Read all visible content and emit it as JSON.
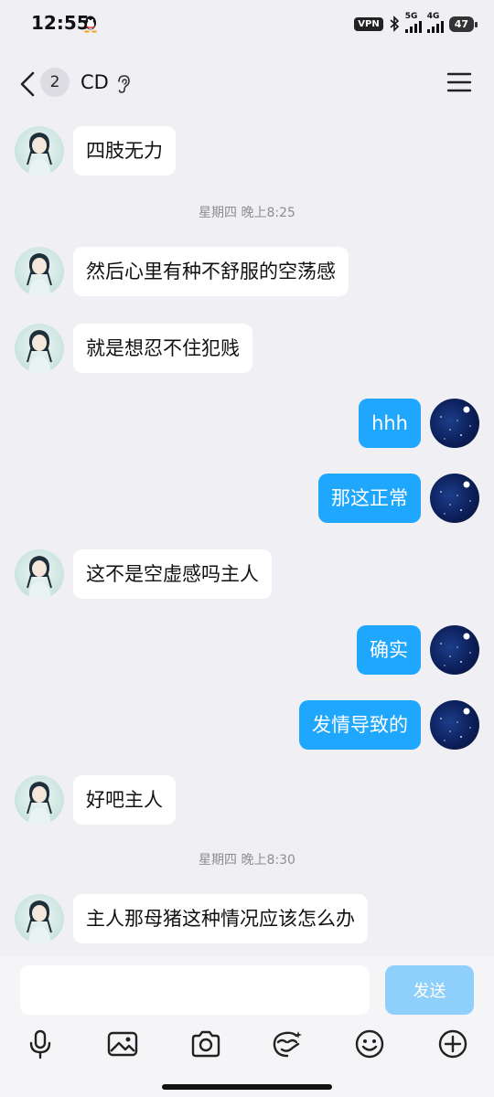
{
  "status": {
    "time": "12:55",
    "vpn": "VPN",
    "net1": "5G",
    "net2": "4G",
    "battery": "47"
  },
  "header": {
    "unread_count": "2",
    "contact_name": "CD"
  },
  "messages": [
    {
      "side": "in",
      "text": "四肢无力"
    },
    {
      "type": "time",
      "text": "星期四 晚上8:25"
    },
    {
      "side": "in",
      "text": "然后心里有种不舒服的空荡感"
    },
    {
      "side": "in",
      "text": "就是想忍不住犯贱"
    },
    {
      "side": "out",
      "text": "hhh"
    },
    {
      "side": "out",
      "text": "那这正常"
    },
    {
      "side": "in",
      "text": "这不是空虚感吗主人"
    },
    {
      "side": "out",
      "text": "确实"
    },
    {
      "side": "out",
      "text": "发情导致的"
    },
    {
      "side": "in",
      "text": "好吧主人"
    },
    {
      "type": "time",
      "text": "星期四 晚上8:30"
    },
    {
      "side": "in",
      "text": "主人那母猪这种情况应该怎么办"
    }
  ],
  "composer": {
    "input_value": "",
    "send_label": "发送"
  },
  "toolbar": [
    "mic-icon",
    "image-icon",
    "camera-icon",
    "sticker-icon",
    "emoji-icon",
    "plus-icon"
  ]
}
